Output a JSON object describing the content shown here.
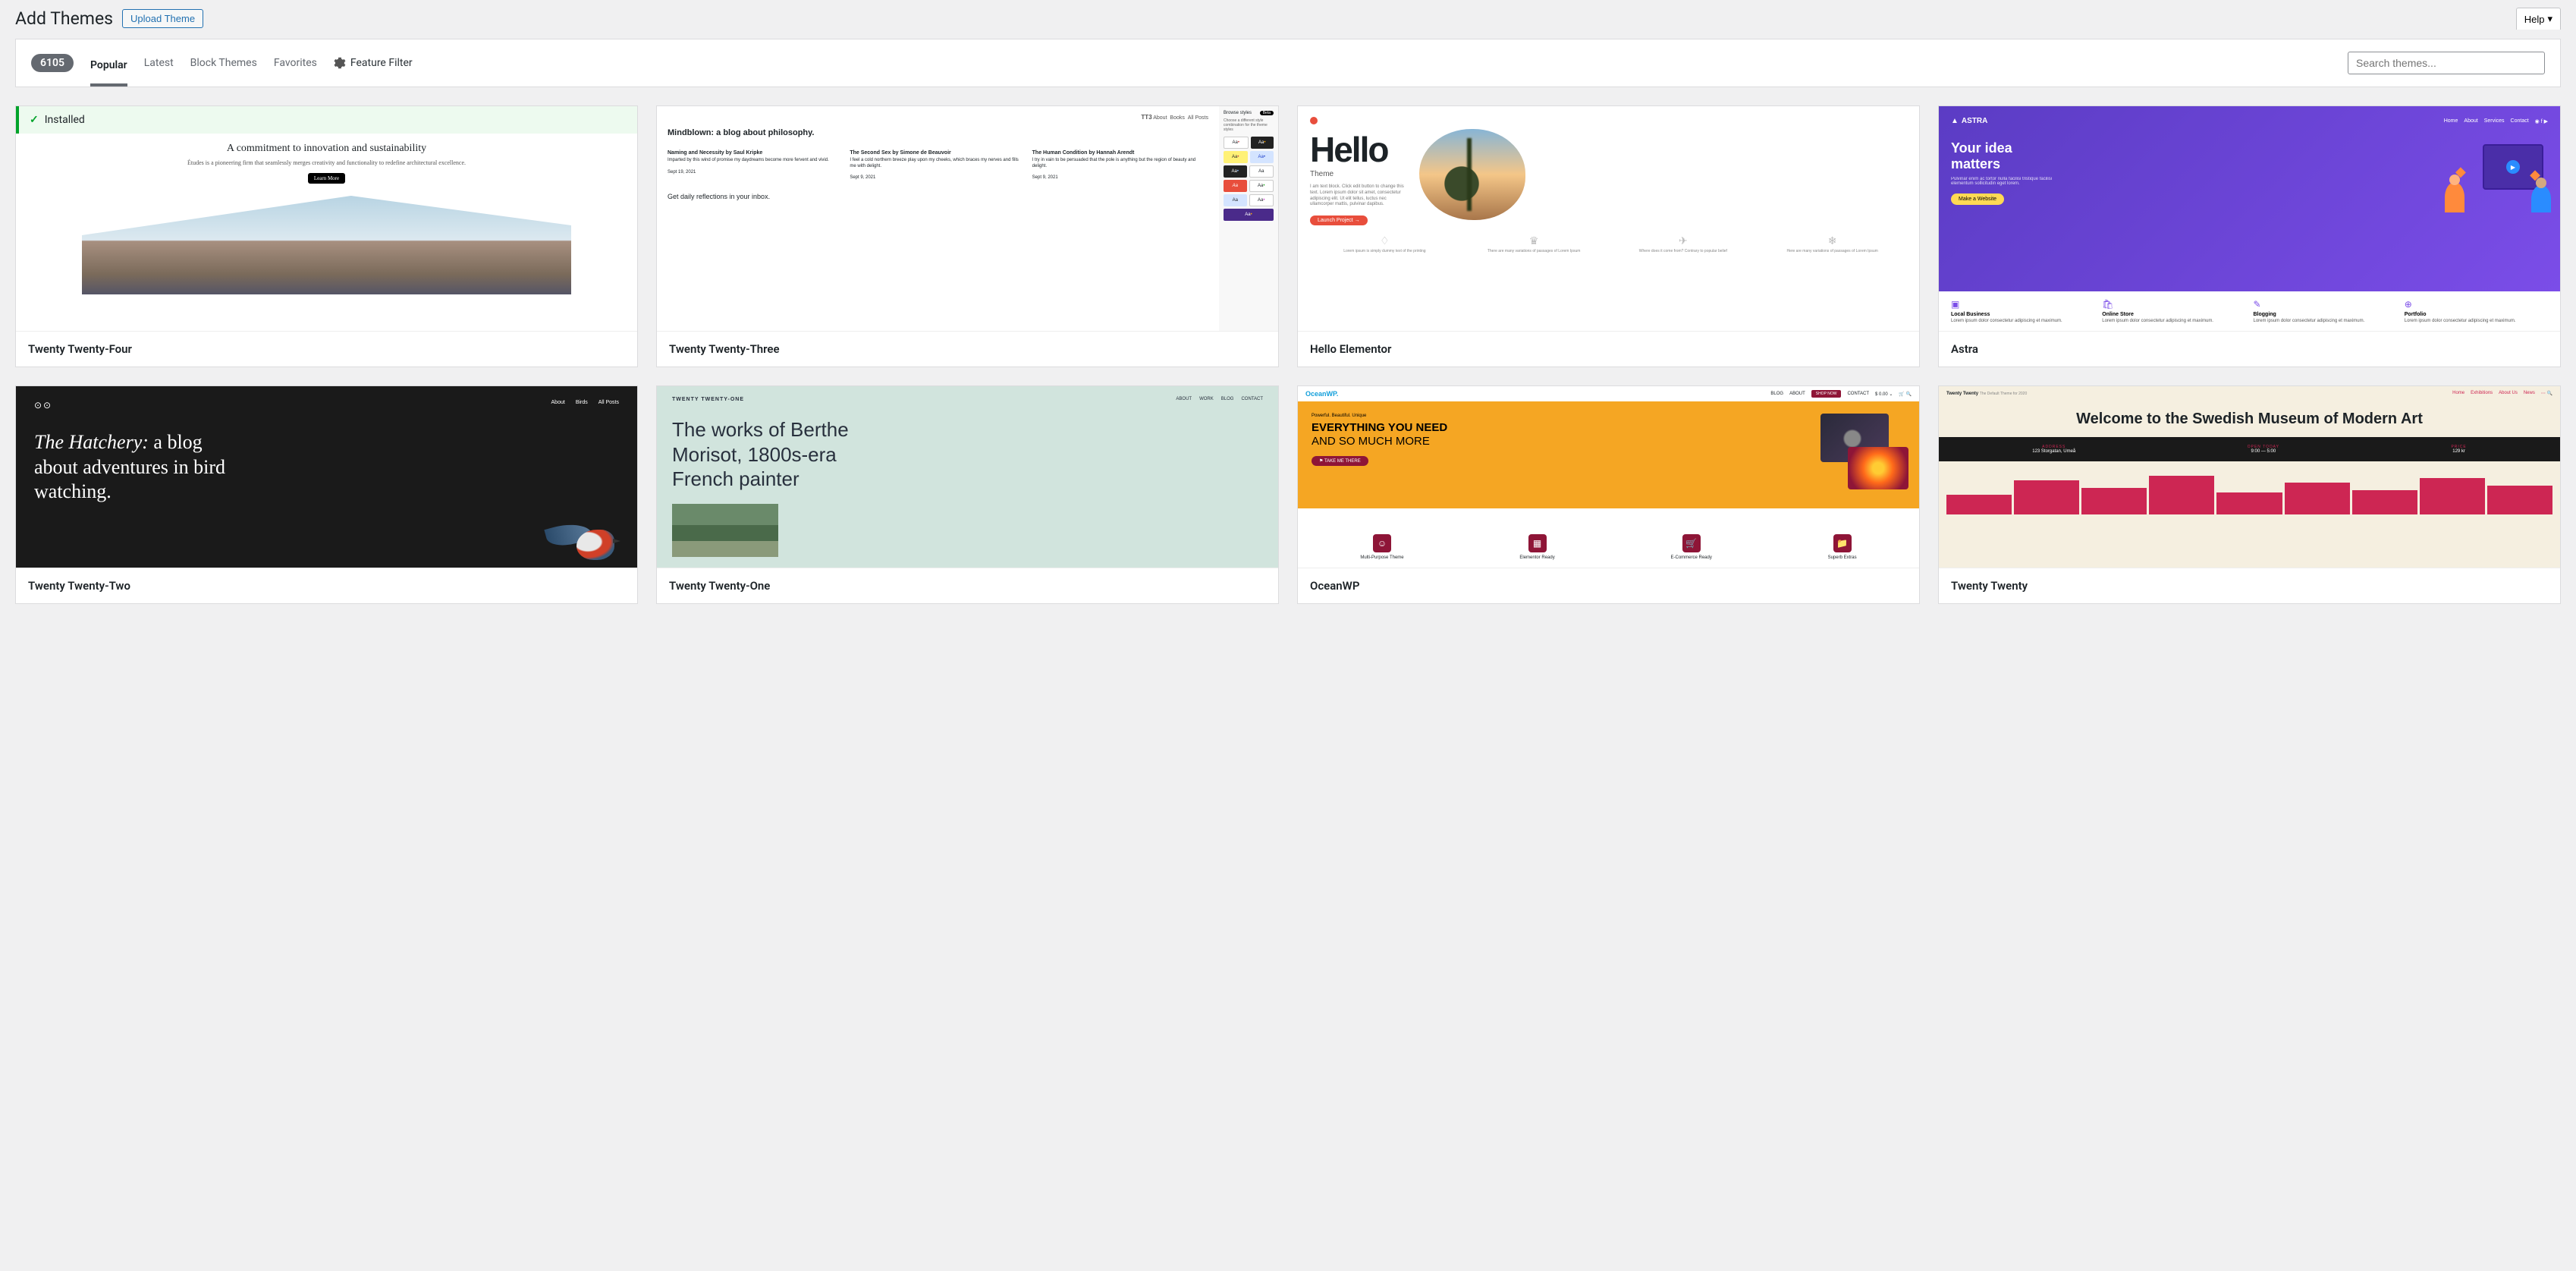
{
  "page_title": "Add Themes",
  "upload_button": "Upload Theme",
  "help_tab": "Help",
  "count": "6105",
  "filter_links": [
    "Popular",
    "Latest",
    "Block Themes",
    "Favorites"
  ],
  "active_filter": "Popular",
  "feature_filter": "Feature Filter",
  "search_placeholder": "Search themes...",
  "installed_label": "Installed",
  "themes": [
    {
      "name": "Twenty Twenty-Four",
      "installed": true
    },
    {
      "name": "Twenty Twenty-Three",
      "installed": false
    },
    {
      "name": "Hello Elementor",
      "installed": false
    },
    {
      "name": "Astra",
      "installed": false
    },
    {
      "name": "Twenty Twenty-Two",
      "installed": false
    },
    {
      "name": "Twenty Twenty-One",
      "installed": false
    },
    {
      "name": "OceanWP",
      "installed": false
    },
    {
      "name": "Twenty Twenty",
      "installed": false
    }
  ],
  "thumbs": {
    "tt24": {
      "heading": "A commitment to innovation and sustainability",
      "sub": "Études is a pioneering firm that seamlessly merges creativity and functionality to redefine architectural excellence.",
      "btn": "Learn More"
    },
    "tt23": {
      "logo": "TT3",
      "nav": [
        "About",
        "Books",
        "All Posts"
      ],
      "headline": "Mindblown: a blog about philosophy.",
      "cols": [
        {
          "t": "Naming and Necessity by Saul Kripke",
          "d": "Sept 19, 2021"
        },
        {
          "t": "The Second Sex by Simone de Beauvoir",
          "d": "Sept 9, 2021"
        },
        {
          "t": "The Human Condition by Hannah Arendt",
          "d": "Sept 9, 2021"
        }
      ],
      "reflections": "Get daily reflections in your inbox.",
      "side_title": "Browse styles",
      "side_badge": "Beta",
      "side_sub": "Choose a different style combination for the theme styles"
    },
    "hello": {
      "h": "Hello",
      "sub": "Theme",
      "lorem": "I am text block. Click edit button to change this text. Lorem ipsum dolor sit amet, consectetur adipiscing elit. Ut elit tellus, luctus nec ullamcorper mattis, pulvinar dapibus.",
      "btn": "Launch Project  →",
      "icons": [
        "Lorem ipsum is simply dummy text of the printing",
        "There are many variations of passages of Lorem Ipsum",
        "Where does it come from? Contrary to popular belief",
        "Here are many variations of passages of Lorem Ipsum"
      ]
    },
    "astra": {
      "logo": "ASTRA",
      "nav": [
        "Home",
        "About",
        "Services",
        "Contact"
      ],
      "h": "Your idea matters",
      "sub": "Pulvinar enim ac tortor nulla facilisi tristique facilisi elementum sollicitudin eget lorem.",
      "btn": "Make a Website",
      "cats": [
        {
          "t": "Local Business",
          "d": "Lorem ipsum dolor consectetur adipiscing et maximum."
        },
        {
          "t": "Online Store",
          "d": "Lorem ipsum dolor consectetur adipiscing et maximum."
        },
        {
          "t": "Blogging",
          "d": "Lorem ipsum dolor consectetur adipiscing et maximum."
        },
        {
          "t": "Portfolio",
          "d": "Lorem ipsum dolor consectetur adipiscing et maximum."
        }
      ]
    },
    "tt22": {
      "nav": [
        "About",
        "Birds",
        "All Posts"
      ],
      "h_italic": "The Hatchery:",
      "h_rest": " a blog about adventures in bird watching."
    },
    "tt21": {
      "logo": "TWENTY TWENTY-ONE",
      "nav": [
        "ABOUT",
        "WORK",
        "BLOG",
        "CONTACT"
      ],
      "h": "The works of Berthe Morisot, 1800s-era French painter"
    },
    "ocean": {
      "logo": "OceanWP.",
      "nav": [
        "BLOG",
        "ABOUT"
      ],
      "shop": "SHOP NOW",
      "nav2": [
        "CONTACT",
        "$ 0.00 ⌄"
      ],
      "tag": "Powerful. Beautiful. Unique",
      "h1": "EVERYTHING YOU NEED",
      "h2": "AND SO MUCH MORE",
      "btn": "⚑ TAKE ME THERE",
      "icons": [
        "Multi-Purpose Theme",
        "Elementor Ready",
        "E-Commerce Ready",
        "Superb Extras"
      ]
    },
    "tt20": {
      "logo": "Twenty Twenty",
      "tag": "The Default Theme for 2020",
      "nav": [
        "Home",
        "Exhibitions",
        "About Us",
        "News"
      ],
      "h": "Welcome to the Swedish Museum of Modern Art",
      "band": [
        {
          "l": "ADDRESS",
          "v": "123 Storgatan, Umeå"
        },
        {
          "l": "OPEN TODAY",
          "v": "9:00 — 5:00"
        },
        {
          "l": "PRICE",
          "v": "129 kr"
        }
      ]
    }
  }
}
